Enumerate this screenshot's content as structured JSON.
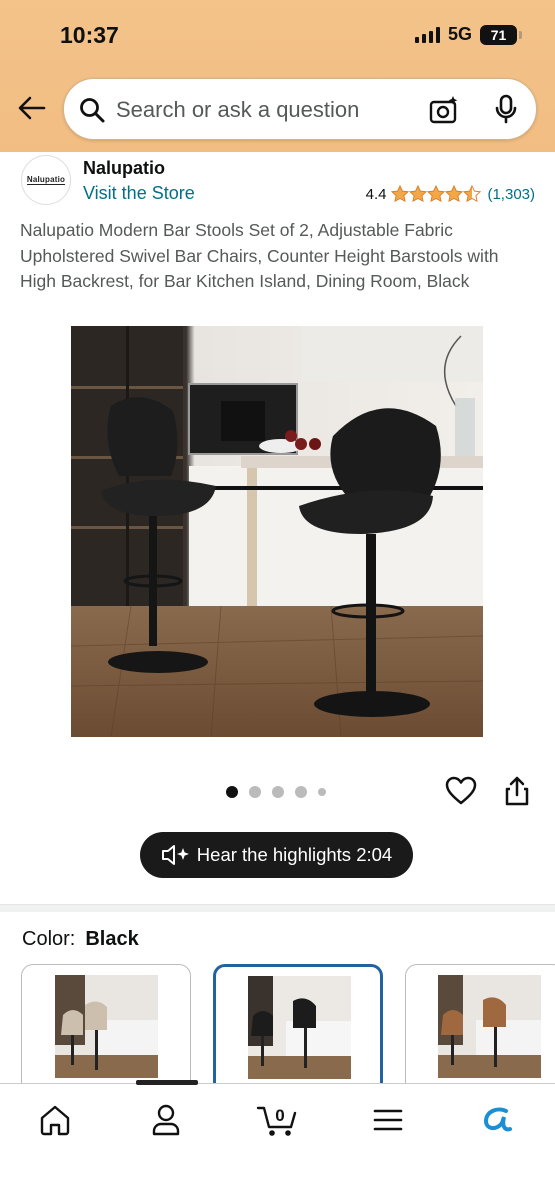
{
  "status_bar": {
    "time": "10:37",
    "network": "5G",
    "battery": "71"
  },
  "search": {
    "placeholder": "Search or ask a question"
  },
  "brand": {
    "logo_text": "Nalupatio",
    "name": "Nalupatio",
    "visit_store": "Visit the Store"
  },
  "rating": {
    "value": "4.4",
    "stars": 4.5,
    "count": "(1,303)"
  },
  "product": {
    "title": "Nalupatio Modern Bar Stools Set of 2, Adjustable Fabric Upholstered Swivel Bar Chairs, Counter Height Barstools with High Backrest, for Bar Kitchen Island, Dining Room, Black"
  },
  "gallery": {
    "image_count": 5,
    "active_index": 0
  },
  "highlights": {
    "label": "Hear the highlights 2:04"
  },
  "color": {
    "label": "Color:",
    "value": "Black",
    "options": [
      "Beige",
      "Black",
      "Brown"
    ],
    "selected_index": 1
  },
  "nav": {
    "items": [
      "home-icon",
      "account-icon",
      "cart-icon",
      "menu-icon",
      "rufus-icon"
    ],
    "cart_count": "0"
  },
  "colors": {
    "accent_link": "#007185",
    "star": "#f3a847",
    "header": "#f3c38a",
    "selected_border": "#2162a1"
  }
}
